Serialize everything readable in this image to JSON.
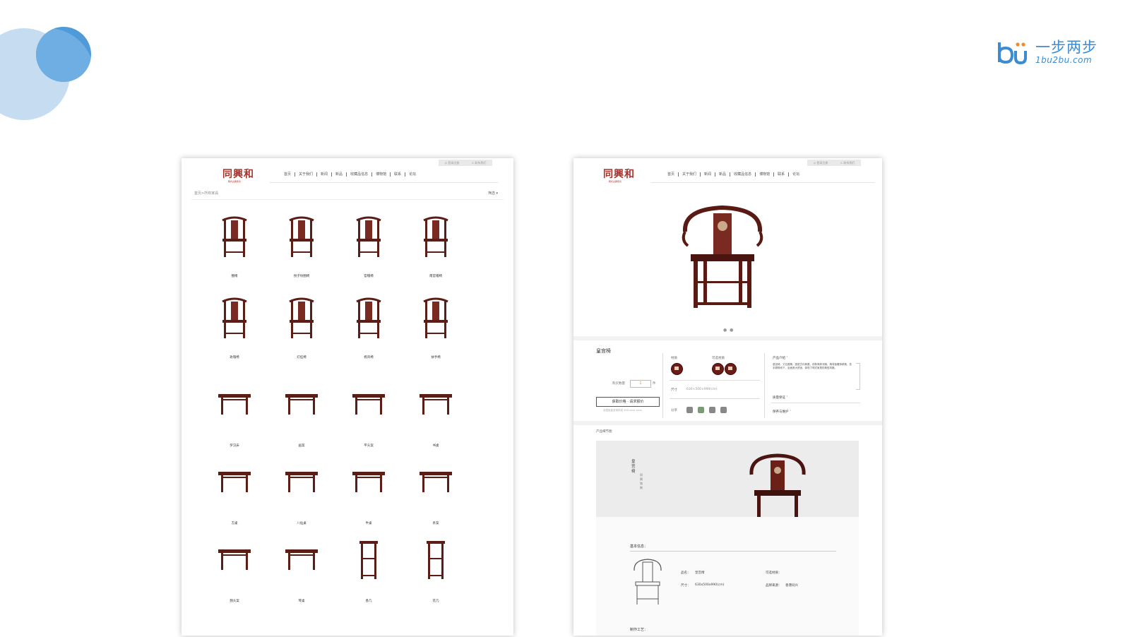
{
  "brand": {
    "name_cn": "一步两步",
    "name_en": "1bu2bu.com",
    "color": "#3d8bd0"
  },
  "site": {
    "logo": "同興和",
    "logo_sub": "· 明式古典家具 ·",
    "top_links": [
      "◎ 登录注册",
      "♙ 联系我们"
    ],
    "nav": [
      "首页",
      "关于我们",
      "新闻",
      "新品",
      "收藏品信息",
      "博物馆",
      "联系",
      "论坛"
    ],
    "accent": "#a8312a"
  },
  "list_page": {
    "breadcrumb": "首页>所有家具",
    "filter": "筛选 ▾",
    "products": [
      {
        "label": "圈椅"
      },
      {
        "label": "拐子纹圈椅"
      },
      {
        "label": "官帽椅"
      },
      {
        "label": "南官帽椅"
      },
      {
        "label": "玫瑰椅"
      },
      {
        "label": "灯挂椅"
      },
      {
        "label": "梳背椅"
      },
      {
        "label": "扶手椅"
      },
      {
        "label": "罗汉床"
      },
      {
        "label": "画案"
      },
      {
        "label": "平头案"
      },
      {
        "label": "书桌"
      },
      {
        "label": "方桌"
      },
      {
        "label": "八仙桌"
      },
      {
        "label": "半桌"
      },
      {
        "label": "条案"
      },
      {
        "label": "翘头案"
      },
      {
        "label": "琴桌"
      },
      {
        "label": "香几"
      },
      {
        "label": "花几"
      }
    ]
  },
  "detail_page": {
    "product_title": "皇宫椅",
    "dots": "● ●",
    "quantity_label": "购买数量",
    "quantity_value": "1",
    "unit": "件",
    "buy_button": "获取价格 · 请求报价",
    "phone": "全国免费咨询热线 400-xxxx-xxxx",
    "material_label": "材质",
    "finish_label": "可选材质",
    "size_label": "尺寸",
    "size_value": "630×500×990(cm)",
    "share_label": "分享",
    "desc_title": "产品介绍 ˅",
    "desc_text": "皇宫椅，又名圈椅，造型古朴典雅，线条简练流畅。椅背板雕饰精美，扶手顺势而下，坐面宽大舒适，体现了明式家具的典型风格。",
    "more_label_1": "质量保证 ˅",
    "more_label_2": "保养与维护 ˅",
    "section_title": "产品细节图",
    "banner_title": "皇宫椅",
    "banner_sub": "同興和制",
    "info_title": "基本信息：",
    "kv": {
      "name_k": "品名：",
      "name_v": "皇宫椅",
      "size_k": "尺寸：",
      "size_v": "630x500x990(cm)",
      "origin_k": "可选材质：",
      "origin_v": "",
      "maker_k": "品牌来源：",
      "maker_v": "香港同兴"
    },
    "made": "制作工艺："
  }
}
